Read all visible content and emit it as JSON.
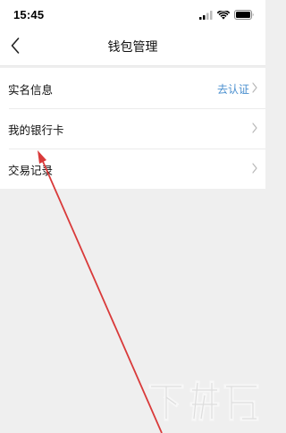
{
  "status_bar": {
    "time": "15:45",
    "icons": [
      "signal-icon",
      "wifi-icon",
      "battery-icon"
    ]
  },
  "header": {
    "title": "钱包管理",
    "back_icon": "chevron-left-icon"
  },
  "menu": {
    "items": [
      {
        "label": "实名信息",
        "status": "去认证",
        "icon": "chevron-right-icon"
      },
      {
        "label": "我的银行卡",
        "icon": "chevron-right-icon"
      },
      {
        "label": "交易记录",
        "icon": "chevron-right-icon"
      }
    ]
  },
  "annotation": {
    "color": "#d93a3a",
    "icon": "arrow-annotation"
  },
  "colors": {
    "accent": "#4a8fcf",
    "background": "#efefef"
  }
}
